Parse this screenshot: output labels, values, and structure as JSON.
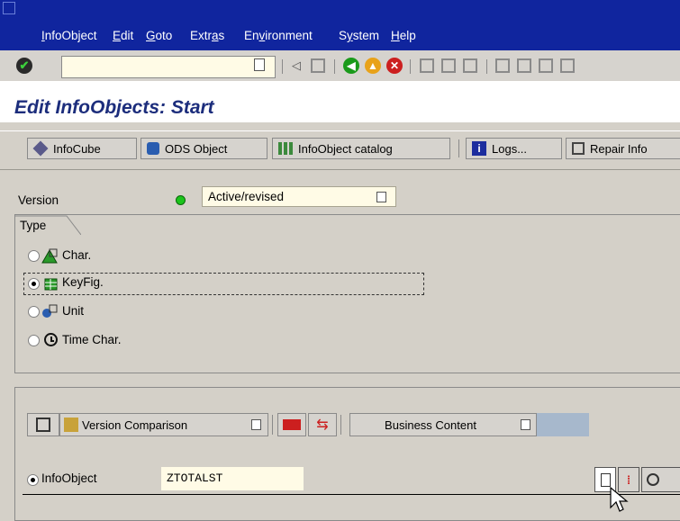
{
  "menu": {
    "items": [
      {
        "label": "InfoObject",
        "u": "I"
      },
      {
        "label": "Edit",
        "u": "E"
      },
      {
        "label": "Goto",
        "u": "G"
      },
      {
        "label": "Extras",
        "u": "a"
      },
      {
        "label": "Environment",
        "u": "v"
      },
      {
        "label": "System",
        "u": "y"
      },
      {
        "label": "Help",
        "u": "H"
      }
    ]
  },
  "toolbar": {
    "command_field_value": "",
    "icons": [
      "enter-icon",
      "back-arrow-icon",
      "save-icon",
      "back-icon",
      "exit-icon",
      "cancel-icon",
      "print-icon",
      "find-icon",
      "find-next-icon",
      "first-page-icon",
      "previous-page-icon",
      "next-page-icon",
      "last-page-icon"
    ]
  },
  "title": "Edit InfoObjects: Start",
  "app_toolbar": {
    "infocube": "InfoCube",
    "ods_object": "ODS Object",
    "infoobject_catalog": "InfoObject catalog",
    "logs": "Logs...",
    "repair": "Repair Info"
  },
  "version": {
    "label": "Version",
    "value": "Active/revised",
    "status_color": "#00c000"
  },
  "type_group": {
    "title": "Type",
    "options": [
      {
        "label": "Char.",
        "selected": false
      },
      {
        "label": "KeyFig.",
        "selected": true
      },
      {
        "label": "Unit",
        "selected": false
      },
      {
        "label": "Time Char.",
        "selected": false
      }
    ]
  },
  "lower_toolbar": {
    "version_comparison": "Version Comparison",
    "business_content": "Business Content"
  },
  "infoobject": {
    "label": "InfoObject",
    "value": "ZTOTALST",
    "selected": true
  },
  "colors": {
    "menubar": "#10259e",
    "title": "#1c2d7c",
    "field_bg": "#fffbe6"
  }
}
